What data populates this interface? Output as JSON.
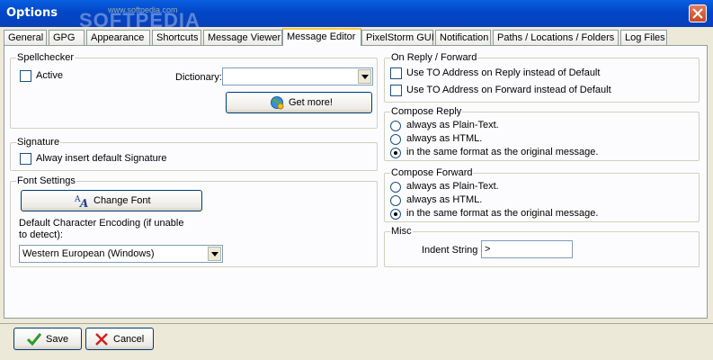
{
  "window": {
    "title": "Options",
    "watermark": "SOFTPEDIA",
    "watermark_url": "www.softpedia.com"
  },
  "tabs": [
    {
      "label": "General"
    },
    {
      "label": "GPG"
    },
    {
      "label": "Appearance"
    },
    {
      "label": "Shortcuts"
    },
    {
      "label": "Message Viewer"
    },
    {
      "label": "Message Editor",
      "active": true
    },
    {
      "label": "PixelStorm GUI"
    },
    {
      "label": "Notification"
    },
    {
      "label": "Paths / Locations / Folders"
    },
    {
      "label": "Log Files"
    }
  ],
  "spellchecker": {
    "title": "Spellchecker",
    "active_label": "Active",
    "active_checked": false,
    "dictionary_label": "Dictionary:",
    "dictionary_value": "",
    "get_more_label": "Get more!"
  },
  "signature": {
    "title": "Signature",
    "insert_label": "Alway insert default Signature",
    "insert_checked": false
  },
  "font_settings": {
    "title": "Font Settings",
    "change_font_label": "Change Font",
    "encoding_label_1": "Default Character Encoding (if unable",
    "encoding_label_2": "to detect):",
    "encoding_value": "Western European (Windows)"
  },
  "reply_forward": {
    "title": "On Reply / Forward",
    "reply_label": "Use TO Address on Reply instead of Default",
    "forward_label": "Use TO Address on Forward instead of Default",
    "reply_checked": false,
    "forward_checked": false
  },
  "compose_reply": {
    "title": "Compose Reply",
    "options": [
      "always as Plain-Text.",
      "always as HTML.",
      "in the same format as the original message."
    ],
    "selected": 2
  },
  "compose_forward": {
    "title": "Compose Forward",
    "options": [
      "always as Plain-Text.",
      "always as HTML.",
      "in the same format as the original message."
    ],
    "selected": 2
  },
  "misc": {
    "title": "Misc",
    "indent_label": "Indent String",
    "indent_value": ">"
  },
  "footer": {
    "save_label": "Save",
    "cancel_label": "Cancel"
  },
  "colors": {
    "title_bar": "#0054E3",
    "face": "#ECE9D8",
    "panel": "#FCFCFE",
    "tab_highlight": "#FFC83C"
  }
}
